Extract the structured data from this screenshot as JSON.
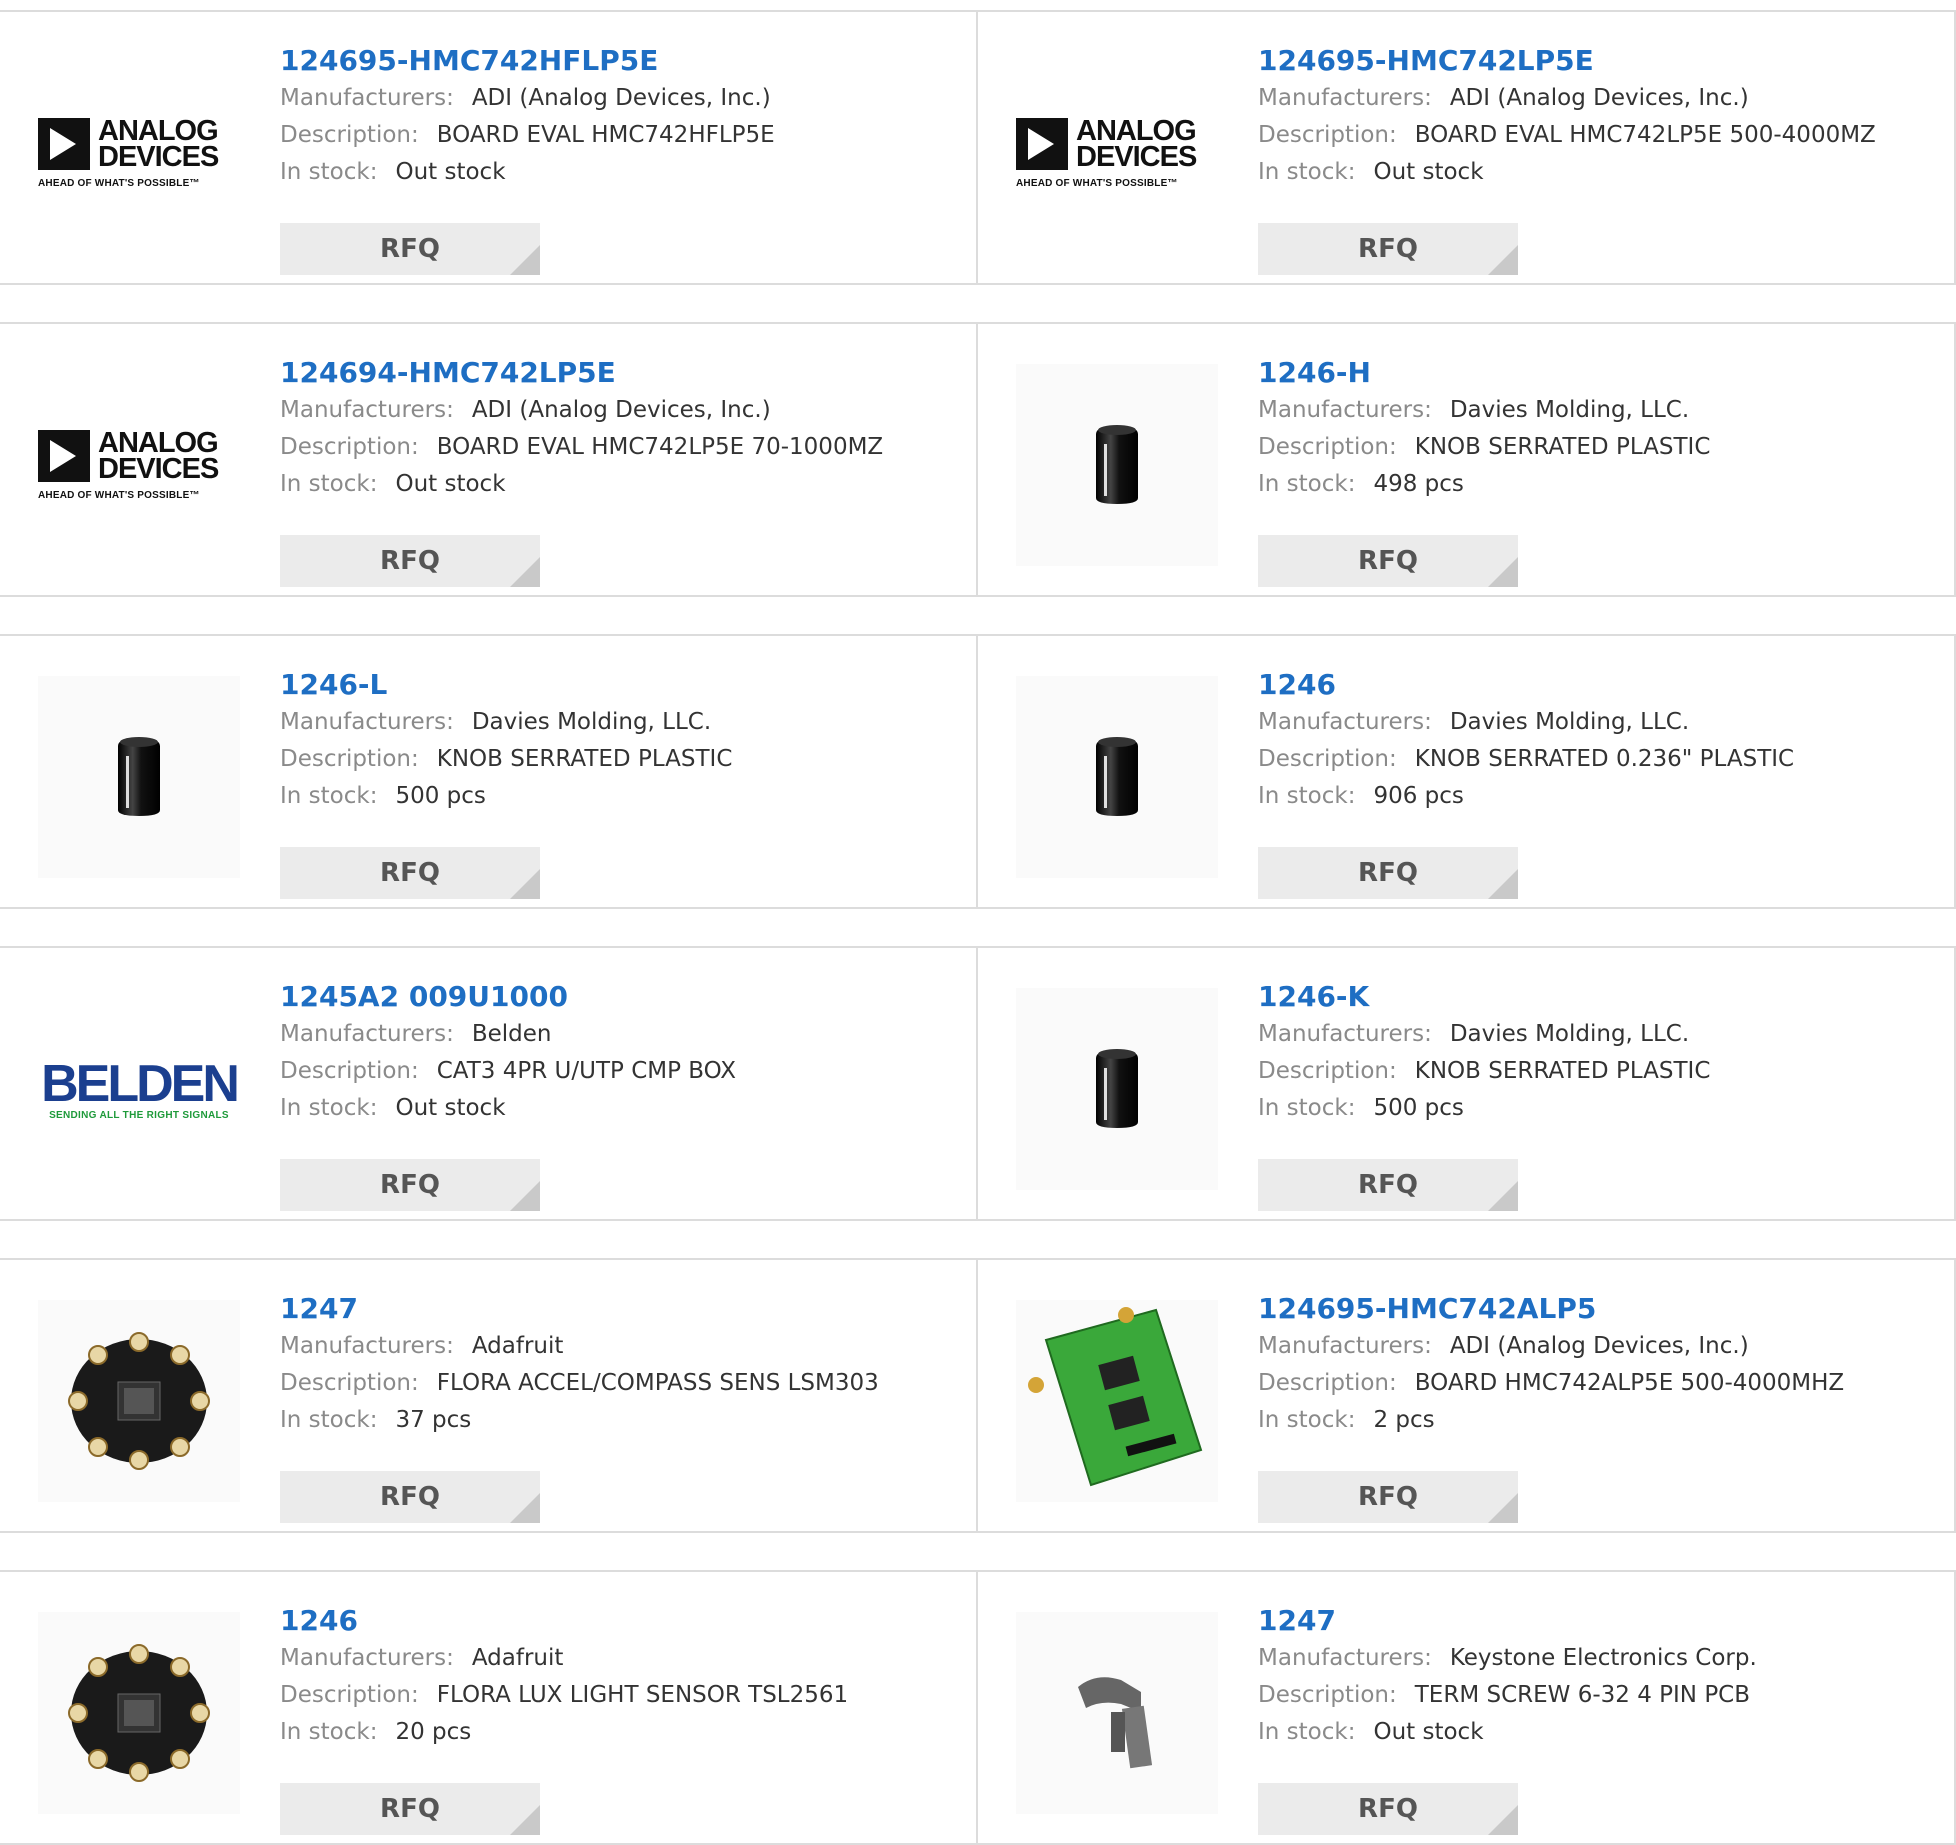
{
  "labels": {
    "manufacturers": "Manufacturers:",
    "description": "Description:",
    "in_stock": "In stock:",
    "rfq": "RFQ"
  },
  "logos": {
    "adi_word1": "ANALOG",
    "adi_word2": "DEVICES",
    "adi_tagline": "AHEAD OF WHAT'S POSSIBLE™",
    "belden_word": "BELDEN",
    "belden_tagline": "SENDING ALL THE RIGHT SIGNALS"
  },
  "products": [
    {
      "part": "124695-HMC742HFLP5E",
      "manufacturer": "ADI (Analog Devices, Inc.)",
      "description": "BOARD EVAL HMC742HFLP5E",
      "stock": "Out stock",
      "image": "adi-logo"
    },
    {
      "part": "124695-HMC742LP5E",
      "manufacturer": "ADI (Analog Devices, Inc.)",
      "description": "BOARD EVAL HMC742LP5E 500-4000MZ",
      "stock": "Out stock",
      "image": "adi-logo"
    },
    {
      "part": "124694-HMC742LP5E",
      "manufacturer": "ADI (Analog Devices, Inc.)",
      "description": "BOARD EVAL HMC742LP5E 70-1000MZ",
      "stock": "Out stock",
      "image": "adi-logo"
    },
    {
      "part": "1246-H",
      "manufacturer": "Davies Molding, LLC.",
      "description": "KNOB SERRATED PLASTIC",
      "stock": "498 pcs",
      "image": "knob"
    },
    {
      "part": "1246-L",
      "manufacturer": "Davies Molding, LLC.",
      "description": "KNOB SERRATED PLASTIC",
      "stock": "500 pcs",
      "image": "knob"
    },
    {
      "part": "1246",
      "manufacturer": "Davies Molding, LLC.",
      "description": "KNOB SERRATED 0.236\" PLASTIC",
      "stock": "906 pcs",
      "image": "knob"
    },
    {
      "part": "1245A2 009U1000",
      "manufacturer": "Belden",
      "description": "CAT3 4PR U/UTP CMP BOX",
      "stock": "Out stock",
      "image": "belden-logo"
    },
    {
      "part": "1246-K",
      "manufacturer": "Davies Molding, LLC.",
      "description": "KNOB SERRATED PLASTIC",
      "stock": "500 pcs",
      "image": "knob"
    },
    {
      "part": "1247",
      "manufacturer": "Adafruit",
      "description": "FLORA ACCEL/COMPASS SENS LSM303",
      "stock": "37 pcs",
      "image": "flora-board"
    },
    {
      "part": "124695-HMC742ALP5",
      "manufacturer": "ADI (Analog Devices, Inc.)",
      "description": "BOARD HMC742ALP5E 500-4000MHZ",
      "stock": "2 pcs",
      "image": "green-pcb"
    },
    {
      "part": "1246",
      "manufacturer": "Adafruit",
      "description": "FLORA LUX LIGHT SENSOR TSL2561",
      "stock": "20 pcs",
      "image": "flora-board"
    },
    {
      "part": "1247",
      "manufacturer": "Keystone Electronics Corp.",
      "description": "TERM SCREW 6-32 4 PIN PCB",
      "stock": "Out stock",
      "image": "terminal"
    }
  ]
}
